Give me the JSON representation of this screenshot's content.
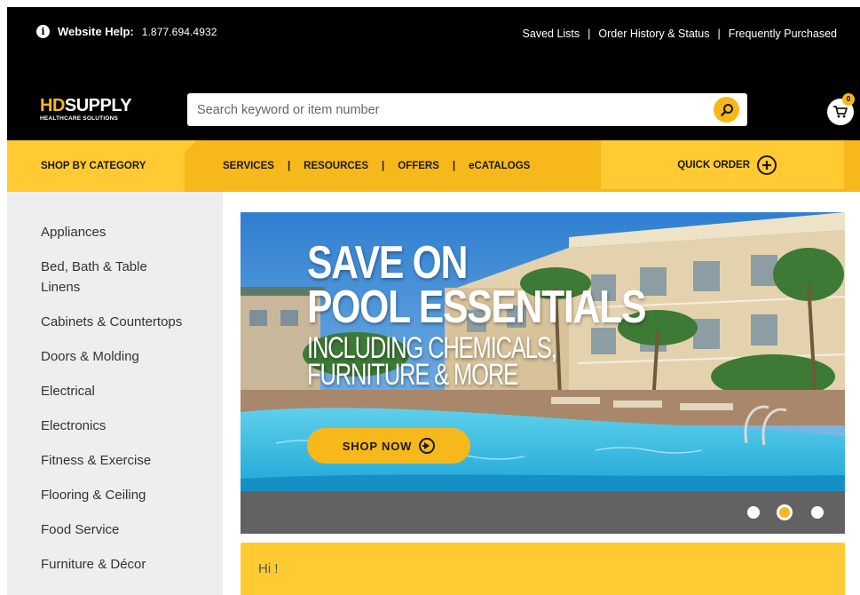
{
  "header": {
    "help_label": "Website Help:",
    "help_phone": "1.877.694.4932",
    "links": [
      "Saved Lists",
      "Order History & Status",
      "Frequently Purchased"
    ],
    "separator": "|"
  },
  "logo": {
    "brand_hd": "HD",
    "brand_supply": "SUPPLY",
    "tagline": "HEALTHCARE SOLUTIONS"
  },
  "search": {
    "placeholder": "Search keyword or item number",
    "value": ""
  },
  "cart": {
    "count": "0"
  },
  "nav": {
    "shop_by_category": "SHOP BY CATEGORY",
    "links": [
      "SERVICES",
      "RESOURCES",
      "OFFERS",
      "eCATALOGS"
    ],
    "separator": "|",
    "quick_order": "QUICK ORDER"
  },
  "sidebar": {
    "categories": [
      "Appliances",
      "Bed, Bath & Table Linens",
      "Cabinets & Countertops",
      "Doors & Molding",
      "Electrical",
      "Electronics",
      "Fitness & Exercise",
      "Flooring & Ceiling",
      "Food Service",
      "Furniture & Décor"
    ]
  },
  "hero": {
    "line1": "SAVE ON",
    "line2": "POOL ESSENTIALS",
    "line3": "INCLUDING CHEMICALS,",
    "line4": "FURNITURE & MORE",
    "cta": "SHOP NOW"
  },
  "carousel": {
    "slide_count": 3,
    "active_slide": 2
  },
  "greeting": {
    "text": "Hi !"
  },
  "colors": {
    "accent_yellow": "#f6b81a",
    "light_yellow": "#ffca32",
    "header_black": "#000000",
    "sidebar_gray": "#eeeeee",
    "carousel_gray": "#626262"
  }
}
